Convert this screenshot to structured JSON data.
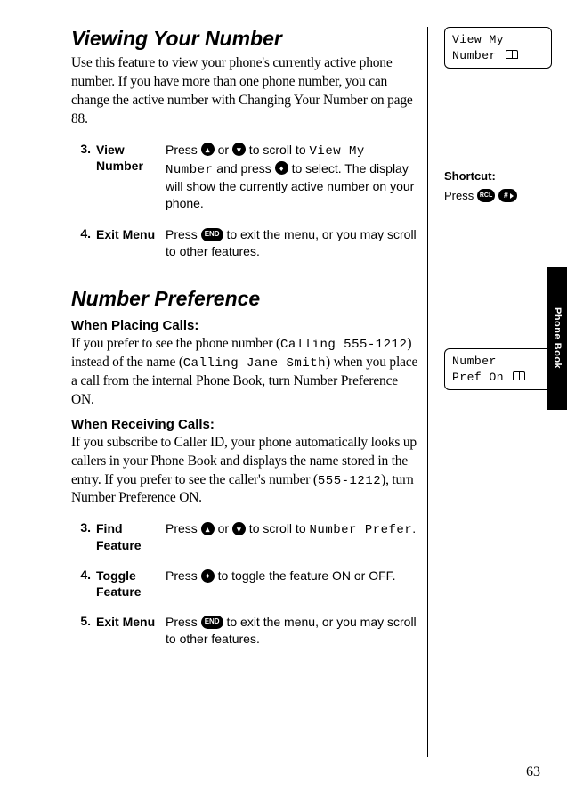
{
  "page_number": "63",
  "side_tab": "Phone Book",
  "section1": {
    "title": "Viewing Your Number",
    "intro": "Use this feature to view your phone's currently active phone number. If you have more than one phone number, you can change the active number with Changing Your Number on page 88.",
    "steps": [
      {
        "num": "3.",
        "label": "View Number",
        "desc_pre": "Press ",
        "desc_mid1": " or ",
        "desc_mid2": " to scroll to ",
        "lcd": "View My Number",
        "desc_mid3": " and press ",
        "desc_post": " to select. The display will show the currently active number on your phone."
      },
      {
        "num": "4.",
        "label": "Exit Menu",
        "desc_pre": "Press ",
        "end_label": "END",
        "desc_post": " to exit the menu, or you may scroll to other features."
      }
    ]
  },
  "section2": {
    "title": "Number Preference",
    "sub1_title": "When Placing Calls:",
    "sub1_body_pre": "If you prefer to see the phone number (",
    "sub1_lcd1": "Calling 555-1212",
    "sub1_body_mid": ") instead of the name (",
    "sub1_lcd2": "Calling Jane Smith",
    "sub1_body_post": ") when you place a call from the internal Phone Book, turn Number Preference ON.",
    "sub2_title": "When Receiving Calls:",
    "sub2_body_pre": "If you subscribe to Caller ID, your phone automatically looks up callers in your Phone Book and displays the name stored in the entry. If you prefer to see the caller's number (",
    "sub2_lcd": "555-1212",
    "sub2_body_post": "), turn Number Preference ON.",
    "steps": [
      {
        "num": "3.",
        "label": "Find Feature",
        "desc_pre": "Press ",
        "desc_mid1": " or ",
        "desc_mid2": " to scroll to ",
        "lcd": "Number Prefer",
        "desc_post": "."
      },
      {
        "num": "4.",
        "label": "Toggle Feature",
        "desc_pre": "Press ",
        "desc_post": " to toggle the feature ON or OFF."
      },
      {
        "num": "5.",
        "label": "Exit Menu",
        "desc_pre": "Press ",
        "end_label": "END",
        "desc_post": " to exit the menu, or you may scroll to other features."
      }
    ]
  },
  "sidebar": {
    "display1_line1": "View My",
    "display1_line2": "Number",
    "shortcut_title": "Shortcut:",
    "shortcut_press": "Press",
    "rcl_label": "RCL",
    "hash_label": "#",
    "display2_line1": "Number",
    "display2_line2": "Pref On"
  }
}
